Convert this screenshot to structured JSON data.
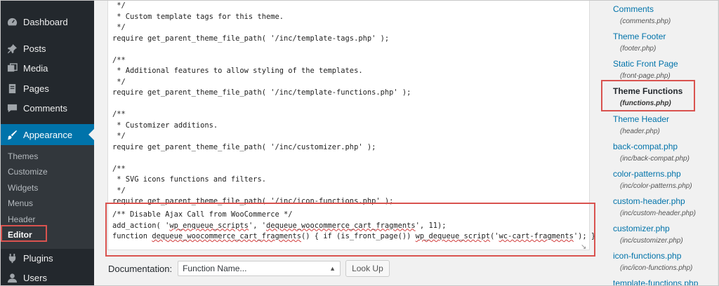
{
  "sidebar": {
    "items": [
      {
        "label": "Dashboard",
        "icon": "dashboard-icon"
      },
      {
        "label": "Posts",
        "icon": "pushpin-icon"
      },
      {
        "label": "Media",
        "icon": "media-icon"
      },
      {
        "label": "Pages",
        "icon": "pages-icon"
      },
      {
        "label": "Comments",
        "icon": "comments-icon"
      },
      {
        "label": "Appearance",
        "icon": "paintbrush-icon"
      },
      {
        "label": "Plugins",
        "icon": "plugin-icon"
      },
      {
        "label": "Users",
        "icon": "user-icon"
      }
    ],
    "submenu": [
      "Themes",
      "Customize",
      "Widgets",
      "Menus",
      "Header",
      "Editor"
    ],
    "accent": "#0073aa"
  },
  "editor": {
    "lines": [
      " */",
      " * Custom template tags for this theme.",
      " */",
      "require get_parent_theme_file_path( '/inc/template-tags.php' );",
      "",
      "/**",
      " * Additional features to allow styling of the templates.",
      " */",
      "require get_parent_theme_file_path( '/inc/template-functions.php' );",
      "",
      "/**",
      " * Customizer additions.",
      " */",
      "require get_parent_theme_file_path( '/inc/customizer.php' );",
      "",
      "/**",
      " * SVG icons functions and filters.",
      " */",
      "require get_parent_theme_file_path( '/inc/icon-functions.php' );"
    ],
    "highlighted": {
      "comment": "/** Disable Ajax Call from WooCommerce */",
      "l2_a": "add_action( '",
      "l2_b": "wp_enqueue_scripts",
      "l2_c": "', '",
      "l2_d": "dequeue_woocommerce_cart_fragments",
      "l2_e": "', 11);",
      "l3_a": "function ",
      "l3_b": "dequeue_woocommerce_cart_fragments",
      "l3_c": "() { if (is_front_page()) ",
      "l3_d": "wp_dequeue_script",
      "l3_e": "('",
      "l3_f": "wc-cart-fragments",
      "l3_g": "'); }"
    }
  },
  "documentation": {
    "label": "Documentation:",
    "selected": "Function Name...",
    "button": "Look Up"
  },
  "files": [
    {
      "title": "Comments",
      "path": "(comments.php)"
    },
    {
      "title": "Theme Footer",
      "path": "(footer.php)"
    },
    {
      "title": "Static Front Page",
      "path": "(front-page.php)"
    },
    {
      "title": "Theme Functions",
      "path": "(functions.php)"
    },
    {
      "title": "Theme Header",
      "path": "(header.php)"
    },
    {
      "title": "back-compat.php",
      "path": "(inc/back-compat.php)"
    },
    {
      "title": "color-patterns.php",
      "path": "(inc/color-patterns.php)"
    },
    {
      "title": "custom-header.php",
      "path": "(inc/custom-header.php)"
    },
    {
      "title": "customizer.php",
      "path": "(inc/customizer.php)"
    },
    {
      "title": "icon-functions.php",
      "path": "(inc/icon-functions.php)"
    },
    {
      "title": "template-functions.php",
      "path": ""
    }
  ]
}
